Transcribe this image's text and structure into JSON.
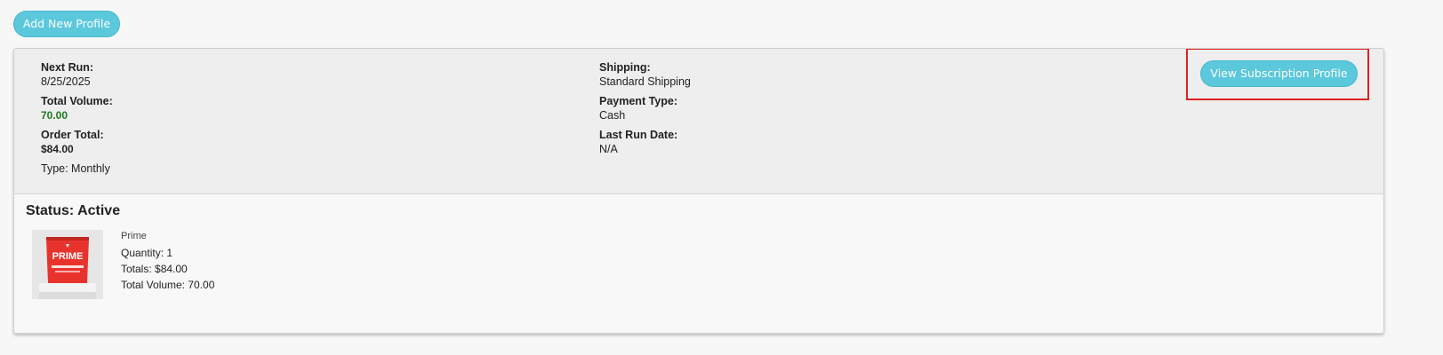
{
  "toolbar": {
    "add_profile_label": "Add New Profile"
  },
  "subscription": {
    "next_run_label": "Next Run:",
    "next_run_value": "8/25/2025",
    "total_volume_label": "Total Volume:",
    "total_volume_value": "70.00",
    "order_total_label": "Order Total:",
    "order_total_value": "$84.00",
    "type_text": "Type: Monthly",
    "shipping_label": "Shipping:",
    "shipping_value": "Standard Shipping",
    "payment_type_label": "Payment Type:",
    "payment_type_value": "Cash",
    "last_run_label": "Last Run Date:",
    "last_run_value": "N/A",
    "view_button_label": "View Subscription Profile",
    "status_text": "Status: Active"
  },
  "product": {
    "name": "Prime",
    "package_text": "PRIME",
    "quantity": "Quantity: 1",
    "totals": "Totals: $84.00",
    "total_volume": "Total Volume: 70.00"
  },
  "colors": {
    "button": "#5bc8dc",
    "highlight_frame": "#e02020",
    "volume_green": "#1e7a1e",
    "package_red": "#e8332d"
  }
}
